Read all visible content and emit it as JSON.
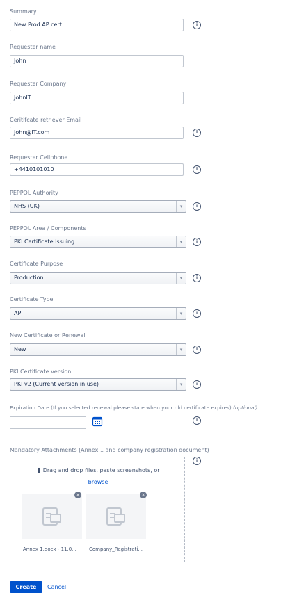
{
  "fields": {
    "summary": {
      "label": "Summary",
      "value": "New Prod AP cert"
    },
    "requester_name": {
      "label": "Requester name",
      "value": "John"
    },
    "requester_company": {
      "label": "Requester Company",
      "value": "JohnIT"
    },
    "retriever_email": {
      "label": "Ceritifcate retriever Email",
      "value": "John@IT.com"
    },
    "cellphone": {
      "label": "Requester Cellphone",
      "value": "+4410101010"
    },
    "authority": {
      "label": "PEPPOL Authority",
      "value": "NHS (UK)"
    },
    "area": {
      "label": "PEPPOL Area / Components",
      "value": "PKI Certificate Issuing"
    },
    "purpose": {
      "label": "Certificate Purpose",
      "value": "Production"
    },
    "cert_type": {
      "label": "Certificate Type",
      "value": "AP"
    },
    "new_or_renewal": {
      "label": "New Certificate or Renewal",
      "value": "New"
    },
    "pki_version": {
      "label": "PKI Certificate version",
      "value": "PKI v2 (Current version in use)"
    },
    "expiration": {
      "label": "Expiration Date (If you selected renewal please state when your old certificate expires)",
      "optional": "(optional)",
      "value": ""
    }
  },
  "attachments": {
    "label": "Mandatory Attachments (Annex 1 and company registration document)",
    "drop_text": "Drag and drop files, paste screenshots, or",
    "browse": "browse",
    "files": [
      {
        "name": "Annex 1.docx - 11.0..."
      },
      {
        "name": "Company_Registrati..."
      }
    ]
  },
  "actions": {
    "create": "Create",
    "cancel": "Cancel"
  },
  "icons": {
    "info": "info-icon",
    "calendar": "calendar-icon",
    "paperclip": "paperclip-icon",
    "close": "close-icon",
    "file": "file-icon"
  },
  "colors": {
    "primary": "#0052cc",
    "label": "#6b778c"
  }
}
